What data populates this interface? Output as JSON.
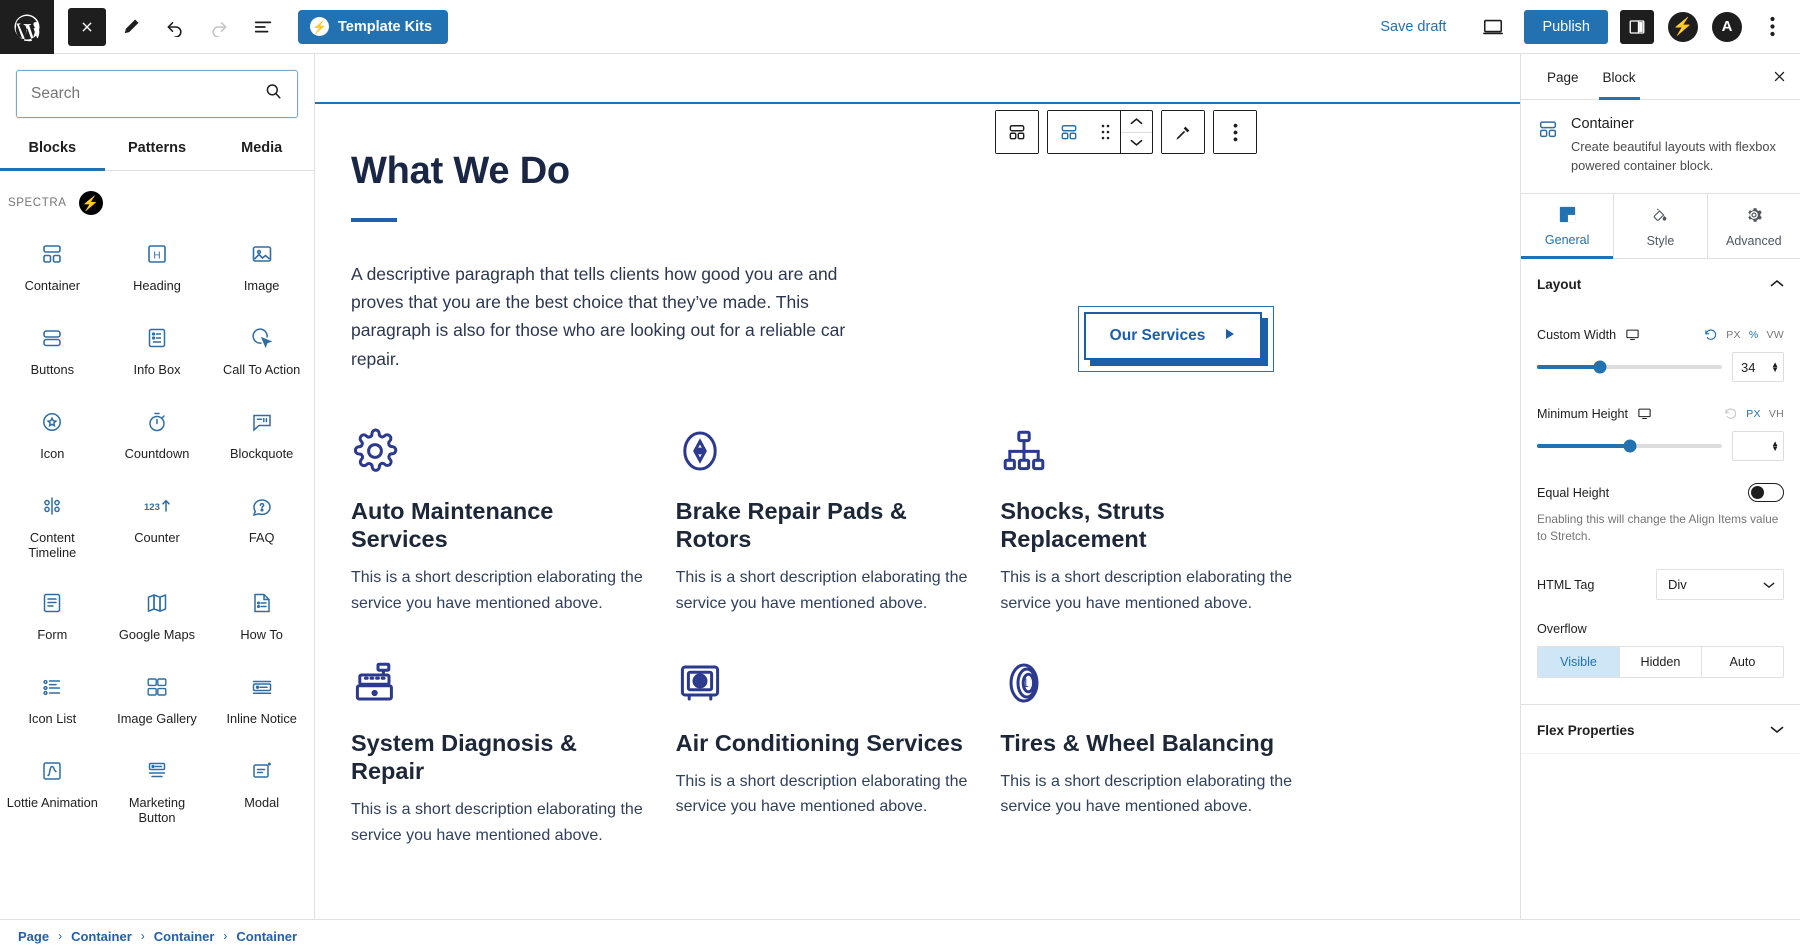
{
  "topbar": {
    "wp_logo": "wordpress-logo",
    "close_label": "Close",
    "edit_label": "Edit",
    "undo_label": "Undo",
    "redo_label": "Redo",
    "list_view_label": "Document Overview",
    "template_kits": "Template Kits",
    "save_draft": "Save draft",
    "preview_label": "Preview",
    "publish": "Publish",
    "settings_label": "Settings",
    "spectra_label": "Spectra",
    "astra_label": "Astra",
    "options_label": "Options"
  },
  "inserter": {
    "search_placeholder": "Search",
    "search_value": "",
    "tabs": [
      {
        "label": "Blocks",
        "active": true
      },
      {
        "label": "Patterns",
        "active": false
      },
      {
        "label": "Media",
        "active": false
      }
    ],
    "category": "SPECTRA",
    "blocks": [
      {
        "label": "Container",
        "icon": "container-icon"
      },
      {
        "label": "Heading",
        "icon": "heading-icon"
      },
      {
        "label": "Image",
        "icon": "image-icon"
      },
      {
        "label": "Buttons",
        "icon": "buttons-icon"
      },
      {
        "label": "Info Box",
        "icon": "info-box-icon"
      },
      {
        "label": "Call To Action",
        "icon": "call-to-action-icon"
      },
      {
        "label": "Icon",
        "icon": "icon-icon"
      },
      {
        "label": "Countdown",
        "icon": "countdown-icon"
      },
      {
        "label": "Blockquote",
        "icon": "blockquote-icon"
      },
      {
        "label": "Content Timeline",
        "icon": "content-timeline-icon"
      },
      {
        "label": "Counter",
        "icon": "counter-icon"
      },
      {
        "label": "FAQ",
        "icon": "faq-icon"
      },
      {
        "label": "Form",
        "icon": "form-icon"
      },
      {
        "label": "Google Maps",
        "icon": "google-maps-icon"
      },
      {
        "label": "How To",
        "icon": "how-to-icon"
      },
      {
        "label": "Icon List",
        "icon": "icon-list-icon"
      },
      {
        "label": "Image Gallery",
        "icon": "image-gallery-icon"
      },
      {
        "label": "Inline Notice",
        "icon": "inline-notice-icon"
      },
      {
        "label": "Lottie Animation",
        "icon": "lottie-animation-icon"
      },
      {
        "label": "Marketing Button",
        "icon": "marketing-button-icon"
      },
      {
        "label": "Modal",
        "icon": "modal-icon"
      }
    ]
  },
  "block_toolbar": {
    "parent_label": "Select parent block: Container",
    "block_type_label": "Container",
    "drag_label": "Drag",
    "move_up_label": "Move up",
    "move_down_label": "Move down",
    "styles_label": "Styles",
    "options_label": "Options"
  },
  "content": {
    "heading": "What We Do",
    "paragraph": "A descriptive paragraph that tells clients how good you are and proves that you are the best choice that they’ve made. This paragraph is also for those who are looking out for a reliable car repair.",
    "cta_button": "Our Services",
    "services": [
      {
        "icon": "gear-icon",
        "title": "Auto Maintenance Services",
        "desc": "This is a short description elaborating the service you have mentioned above."
      },
      {
        "icon": "compass-icon",
        "title": "Brake Repair Pads & Rotors",
        "desc": "This is a short description elaborating the service you have mentioned above."
      },
      {
        "icon": "hierarchy-icon",
        "title": "Shocks, Struts Replacement",
        "desc": "This is a short description elaborating the service you have mentioned above."
      },
      {
        "icon": "cash-register-icon",
        "title": "System Diagnosis & Repair",
        "desc": "This is a short description elaborating the service you have mentioned above."
      },
      {
        "icon": "safe-box-icon",
        "title": "Air Conditioning Services",
        "desc": "This is a short description elaborating the service you have mentioned above."
      },
      {
        "icon": "tire-icon",
        "title": "Tires & Wheel Balancing",
        "desc": "This is a short description elaborating the service you have mentioned above."
      }
    ]
  },
  "settings": {
    "tabs": [
      {
        "label": "Page",
        "active": false
      },
      {
        "label": "Block",
        "active": true
      }
    ],
    "close_label": "Close settings",
    "block_name": "Container",
    "block_desc": "Create beautiful layouts with flexbox powered container block.",
    "sections": [
      {
        "label": "General",
        "icon": "general-icon",
        "active": true
      },
      {
        "label": "Style",
        "icon": "style-icon",
        "active": false
      },
      {
        "label": "Advanced",
        "icon": "advanced-icon",
        "active": false
      }
    ],
    "layout_panel": {
      "title": "Layout",
      "custom_width": {
        "label": "Custom Width",
        "device_icon": "desktop-icon",
        "reset_icon": "reset-icon",
        "units": [
          {
            "label": "PX",
            "selected": false
          },
          {
            "label": "%",
            "selected": true
          },
          {
            "label": "VW",
            "selected": false
          }
        ],
        "value": "34",
        "slider_percent": 34
      },
      "minimum_height": {
        "label": "Minimum Height",
        "device_icon": "desktop-icon",
        "reset_icon": "reset-icon",
        "units": [
          {
            "label": "PX",
            "selected": true
          },
          {
            "label": "VH",
            "selected": false
          }
        ],
        "value": "",
        "slider_percent": 50
      },
      "equal_height": {
        "label": "Equal Height",
        "enabled": false,
        "hint": "Enabling this will change the Align Items value to Stretch."
      },
      "html_tag": {
        "label": "HTML Tag",
        "value": "Div"
      },
      "overflow": {
        "label": "Overflow",
        "options": [
          {
            "label": "Visible",
            "selected": true
          },
          {
            "label": "Hidden",
            "selected": false
          },
          {
            "label": "Auto",
            "selected": false
          }
        ]
      }
    },
    "flex_panel": {
      "title": "Flex Properties"
    }
  },
  "breadcrumb": {
    "items": [
      "Page",
      "Container",
      "Container",
      "Container"
    ],
    "separator": "›"
  },
  "colors": {
    "accent": "#2271b1",
    "brand_dark": "#1e1e1e",
    "content_blue": "#2b3a8f",
    "heading": "#1d2738"
  }
}
